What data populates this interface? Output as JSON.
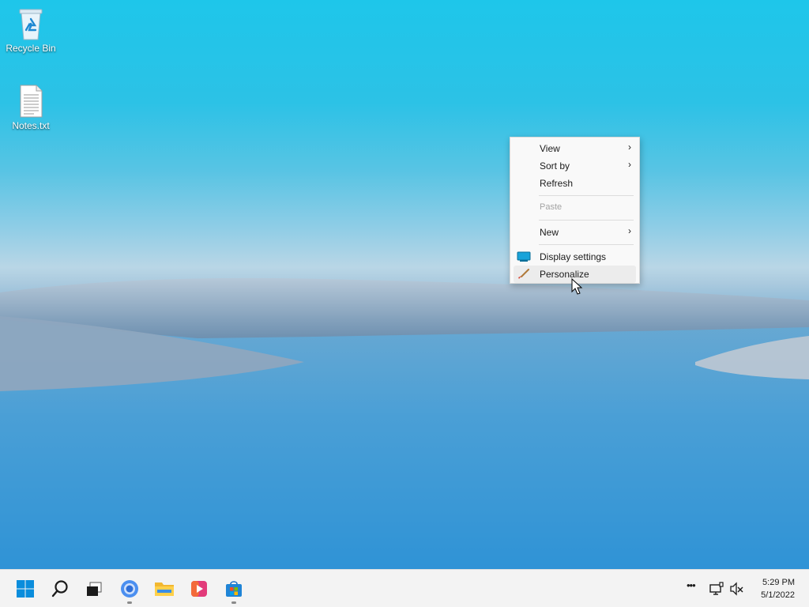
{
  "desktop": {
    "icons": [
      {
        "name": "recycle-bin",
        "label": "Recycle Bin",
        "icon": "recycle-bin-icon"
      },
      {
        "name": "notes-file",
        "label": "Notes.txt",
        "icon": "text-file-icon"
      }
    ]
  },
  "context_menu": {
    "items": [
      {
        "label": "View",
        "has_submenu": true,
        "enabled": true
      },
      {
        "label": "Sort by",
        "has_submenu": true,
        "enabled": true
      },
      {
        "label": "Refresh",
        "has_submenu": false,
        "enabled": true
      },
      {
        "label": "Paste",
        "has_submenu": false,
        "enabled": false
      },
      {
        "label": "New",
        "has_submenu": true,
        "enabled": true
      },
      {
        "label": "Display settings",
        "has_submenu": false,
        "enabled": true,
        "icon": "display-icon"
      },
      {
        "label": "Personalize",
        "has_submenu": false,
        "enabled": true,
        "icon": "paintbrush-icon",
        "hovered": true
      }
    ],
    "submenu_arrow": "›"
  },
  "taskbar": {
    "apps": [
      {
        "name": "start",
        "icon": "windows-logo-icon",
        "running": false
      },
      {
        "name": "search",
        "icon": "search-icon",
        "running": false
      },
      {
        "name": "task-view",
        "icon": "task-view-icon",
        "running": false
      },
      {
        "name": "browser",
        "icon": "chromium-icon",
        "running": true
      },
      {
        "name": "file-explorer",
        "icon": "folder-icon",
        "running": false
      },
      {
        "name": "media-player",
        "icon": "media-player-icon",
        "running": false
      },
      {
        "name": "store",
        "icon": "store-icon",
        "running": true
      }
    ],
    "tray": {
      "overflow": "•••",
      "icons": [
        "network-icon",
        "volume-muted-icon"
      ]
    },
    "clock": {
      "time": "5:29 PM",
      "date": "5/1/2022"
    }
  },
  "colors": {
    "accent": "#0078d4",
    "taskbar_bg": "#f3f3f3",
    "menu_bg": "#f9f9f9"
  }
}
